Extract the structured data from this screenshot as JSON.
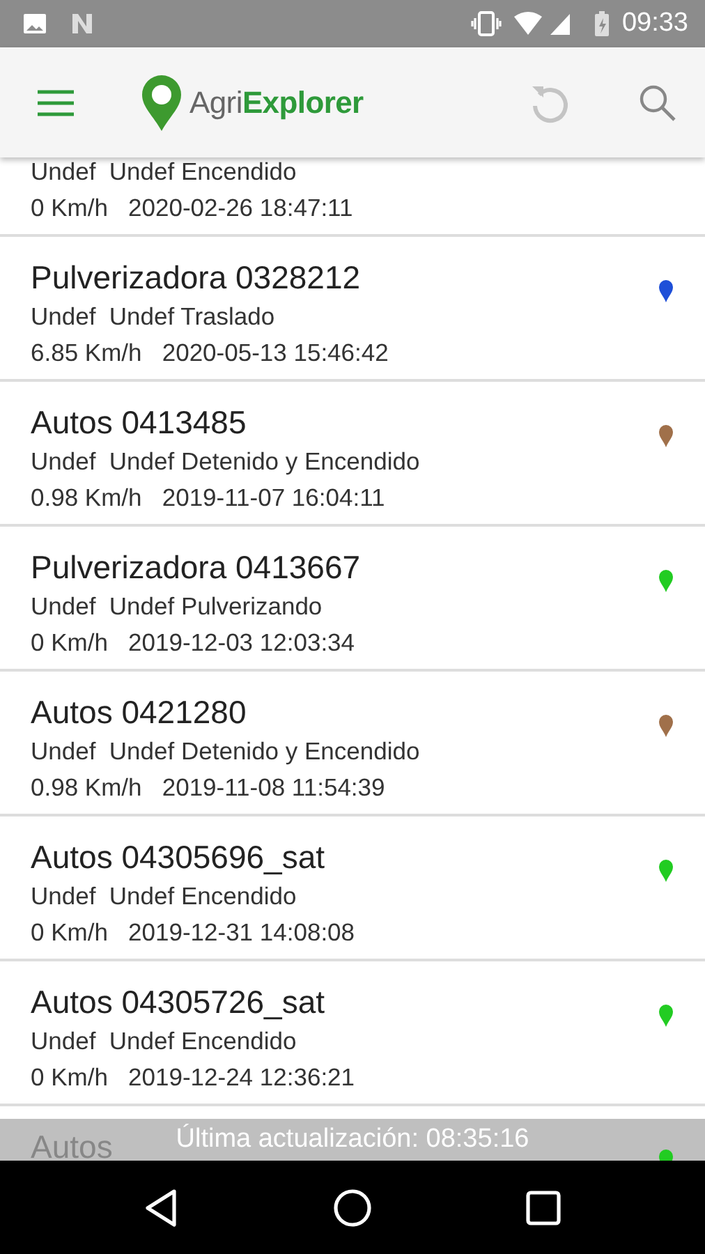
{
  "status_bar": {
    "time": "09:33"
  },
  "app_bar": {
    "logo": "Agri**Explorer**"
  },
  "vehicles": [
    {
      "status": "Undef  Undef Encendido",
      "reading": "0 Km/h   2020-02-26 18:47:11"
    },
    {
      "title": "Pulverizadora 0328212",
      "status": "Undef  Undef Traslado",
      "reading": "6.85 Km/h   2020-05-13 15:46:42",
      "color": "#1e4fd8"
    },
    {
      "title": "Autos 0413485",
      "status": "Undef  Undef Detenido y Encendido",
      "reading": "0.98 Km/h   2019-11-07 16:04:11",
      "color": "#a0704a"
    },
    {
      "title": "Pulverizadora 0413667",
      "status": "Undef  Undef Pulverizando",
      "reading": "0 Km/h   2019-12-03 12:03:34",
      "color": "#22cc22"
    },
    {
      "title": "Autos 0421280",
      "status": "Undef  Undef Detenido y Encendido",
      "reading": "0.98 Km/h   2019-11-08 11:54:39",
      "color": "#a0704a"
    },
    {
      "title": "Autos 04305696_sat",
      "status": "Undef  Undef Encendido",
      "reading": "0 Km/h   2019-12-31 14:08:08",
      "color": "#22cc22"
    },
    {
      "title": "Autos 04305726_sat",
      "status": "Undef  Undef Encendido",
      "reading": "0 Km/h   2019-12-24 12:36:21",
      "color": "#22cc22"
    },
    {
      "title": "Autos",
      "color": "#22cc22"
    }
  ],
  "toast": "Última actualización: 08:35:16"
}
